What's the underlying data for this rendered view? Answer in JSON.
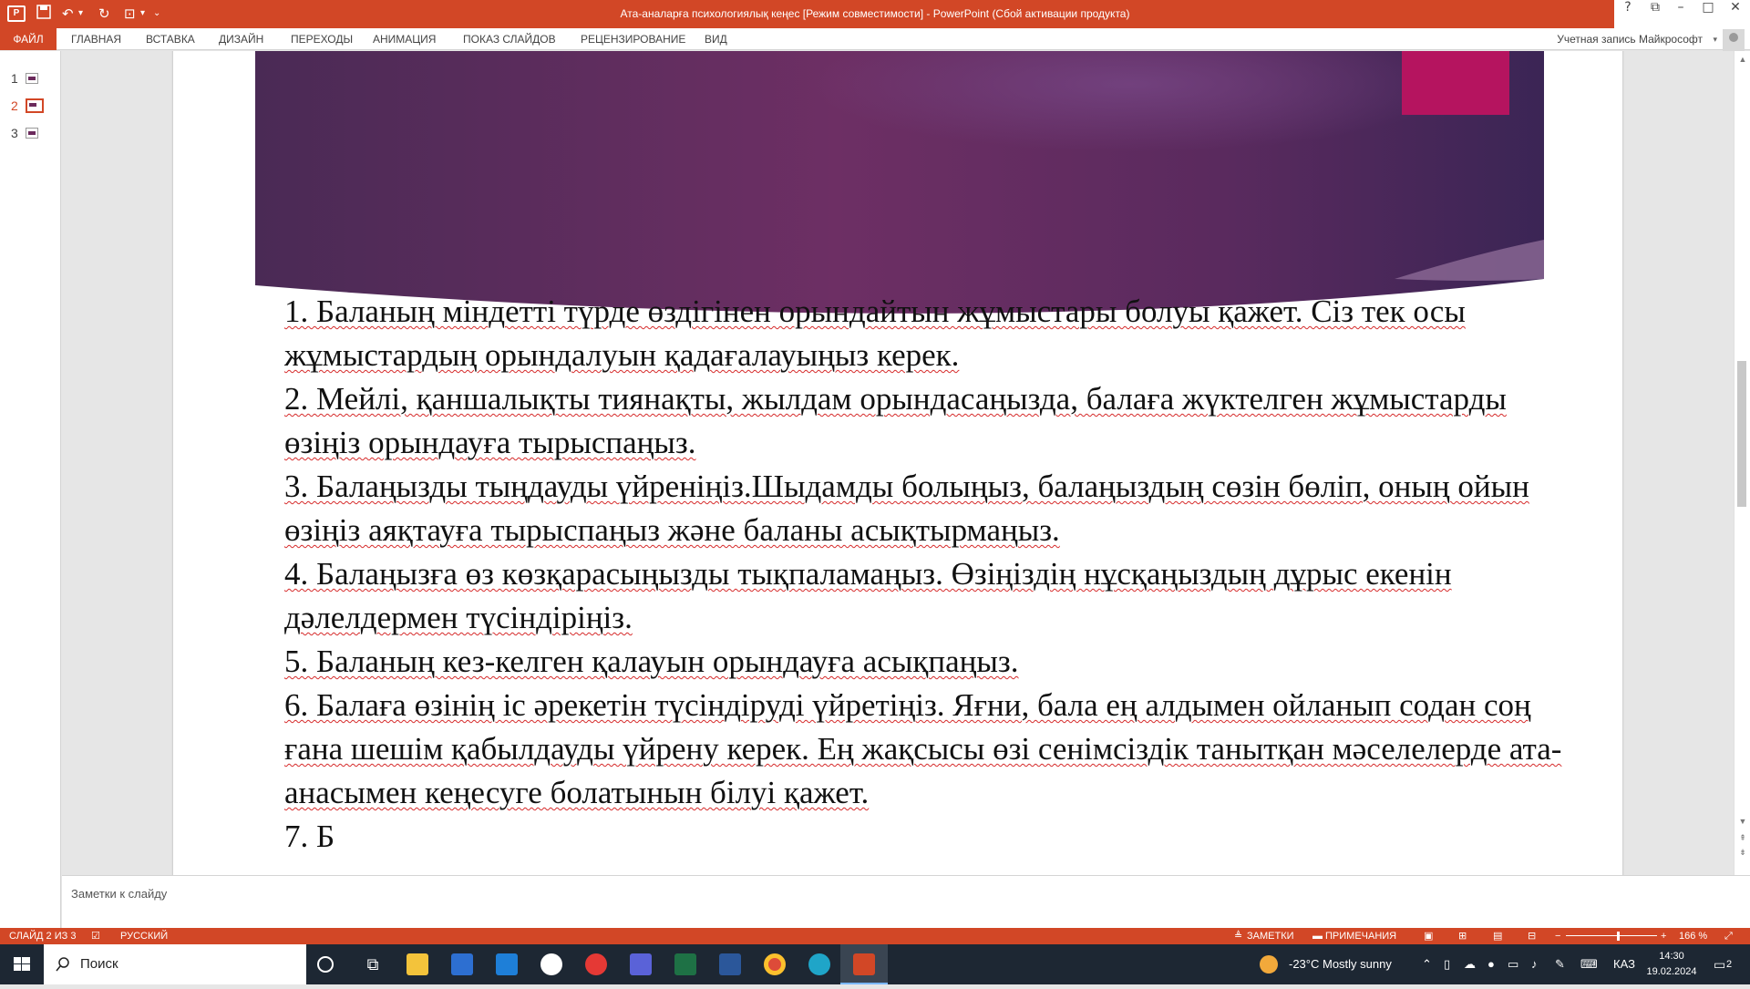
{
  "titlebar": {
    "title": "Ата-аналарға психологиялық кеңес [Режим совместимости] -  PowerPoint (Сбой активации продукта)",
    "help": "?",
    "minimize": "–",
    "maximize": "□",
    "close": "✕"
  },
  "ribbon": {
    "tabs": [
      "ФАЙЛ",
      "ГЛАВНАЯ",
      "ВСТАВКА",
      "ДИЗАЙН",
      "ПЕРЕХОДЫ",
      "АНИМАЦИЯ",
      "ПОКАЗ СЛАЙДОВ",
      "РЕЦЕНЗИРОВАНИЕ",
      "ВИД"
    ],
    "account": "Учетная запись Майкрософт"
  },
  "thumbnails": [
    "1",
    "2",
    "3"
  ],
  "slide": {
    "items": [
      "1. Баланың міндетті түрде өздігінен орындайтын жұмыстары болуы қажет. Сіз тек осы жұмыстардың орындалуын қадағалауыңыз керек.",
      "2. Мейлі, қаншалықты тиянақты, жылдам орындасаңызда, балаға жүктелген жұмыстарды өзіңіз орындауға тырыспаңыз.",
      "3. Балаңызды тыңдауды үйреніңіз.Шыдамды болыңыз, балаңыздың сөзін бөліп, оның ойын өзіңіз аяқтауға тырыспаңыз және баланы асықтырмаңыз.",
      "4. Балаңызға өз көзқарасыңызды тықпаламаңыз. Өзіңіздің нұсқаңыздың дұрыс екенін дәлелдермен түсіндіріңіз.",
      "5. Баланың кез-келген қалауын орындауға асықпаңыз.",
      "6. Балаға өзінің іс әрекетін түсіндіруді үйретіңіз. Яғни, бала ең алдымен ойланып содан соң ғана шешім қабылдауды үйрену керек. Ең жақсысы өзі сенімсіздік танытқан мәселелерде ата-анасымен кеңесуге болатынын білуі қажет.",
      "7. Б"
    ]
  },
  "notes": {
    "placeholder": "Заметки к слайду"
  },
  "status": {
    "slide_info": "СЛАЙД 2 ИЗ 3",
    "language": "РУССКИЙ",
    "notes_btn": "ЗАМЕТКИ",
    "comments_btn": "ПРИМЕЧАНИЯ",
    "zoom": "166 %"
  },
  "taskbar": {
    "search_placeholder": "Поиск",
    "weather": "-23°C  Mostly sunny",
    "lang": "КАЗ",
    "time": "14:30",
    "date": "19.02.2024",
    "notifications": "2"
  },
  "colors": {
    "accent": "#d24726",
    "taskbar": "#1d2733",
    "banner": "#5e2a62"
  }
}
